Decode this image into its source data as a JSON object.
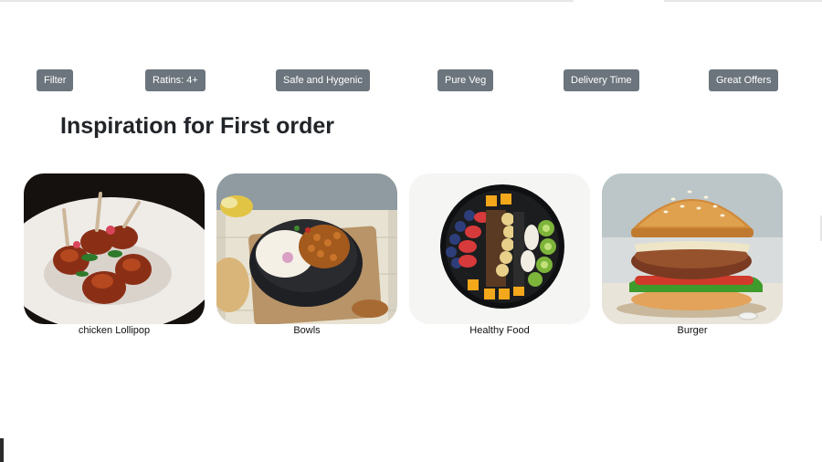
{
  "filters": [
    {
      "label": "Filter"
    },
    {
      "label": "Ratins: 4+"
    },
    {
      "label": "Safe and Hygenic"
    },
    {
      "label": "Pure Veg"
    },
    {
      "label": "Delivery Time"
    },
    {
      "label": "Great Offers"
    }
  ],
  "section": {
    "title": "Inspiration for First order"
  },
  "cards": [
    {
      "label": "chicken Lollipop"
    },
    {
      "label": "Bowls"
    },
    {
      "label": "Healthy Food"
    },
    {
      "label": "Burger"
    }
  ],
  "colors": {
    "button_bg": "#6c757d",
    "button_text": "#ffffff",
    "heading": "#212529"
  }
}
